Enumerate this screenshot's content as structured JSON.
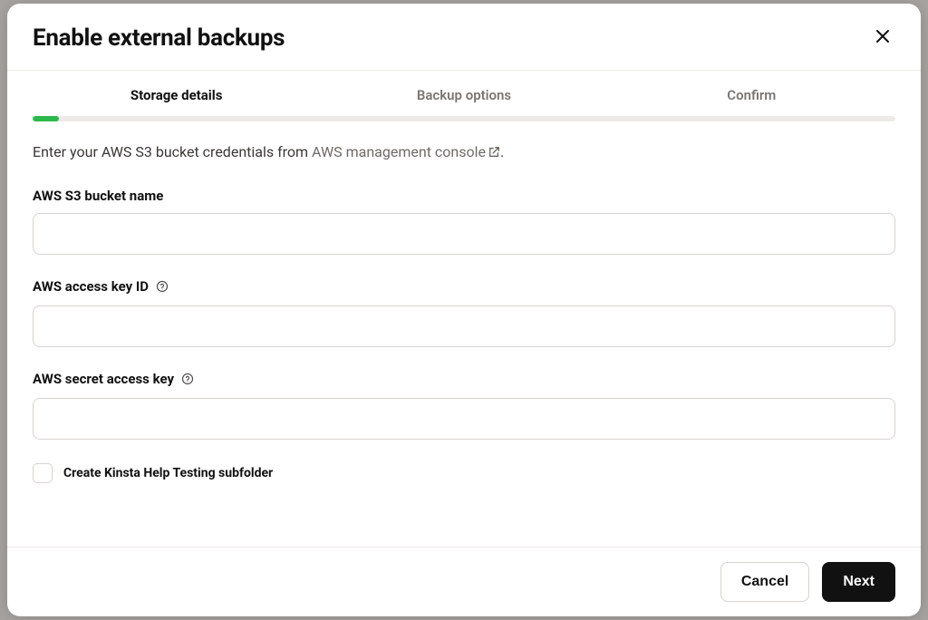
{
  "modal": {
    "title": "Enable external backups"
  },
  "steps": {
    "items": [
      {
        "label": "Storage details",
        "active": true
      },
      {
        "label": "Backup options",
        "active": false
      },
      {
        "label": "Confirm",
        "active": false
      }
    ],
    "progress_percent": 3
  },
  "intro": {
    "prefix": "Enter your AWS S3 bucket credentials from ",
    "link_text": "AWS management console",
    "suffix": "."
  },
  "fields": {
    "bucket_name": {
      "label": "AWS S3 bucket name",
      "value": ""
    },
    "access_key": {
      "label": "AWS access key ID",
      "value": ""
    },
    "secret_key": {
      "label": "AWS secret access key",
      "value": ""
    }
  },
  "checkbox": {
    "label": "Create Kinsta Help Testing subfolder",
    "checked": false
  },
  "footer": {
    "cancel": "Cancel",
    "next": "Next"
  }
}
